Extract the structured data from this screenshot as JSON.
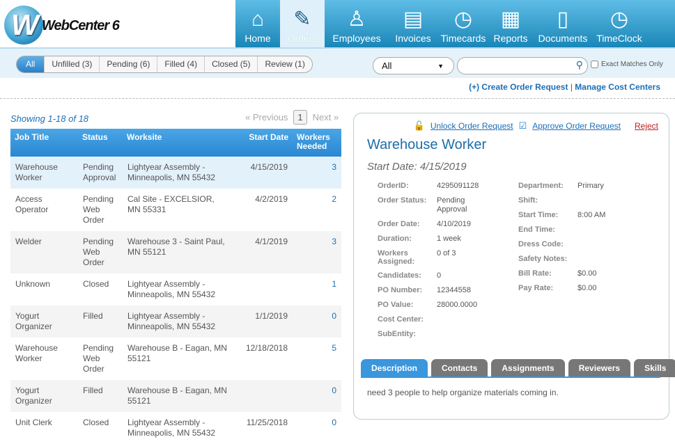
{
  "app": {
    "logo_text": "WebCenter 6",
    "logo_letter": "W"
  },
  "nav": [
    {
      "label": "Home",
      "icon": "home-icon",
      "glyph": "⌂"
    },
    {
      "label": "Orders",
      "icon": "notepad-pencil-icon",
      "glyph": "✎",
      "active": true
    },
    {
      "label": "Employees",
      "icon": "person-icon",
      "glyph": "♙"
    },
    {
      "label": "Invoices",
      "icon": "invoice-icon",
      "glyph": "▤"
    },
    {
      "label": "Timecards",
      "icon": "clock-icon",
      "glyph": "◷"
    },
    {
      "label": "Reports",
      "icon": "report-download-icon",
      "glyph": "▦"
    },
    {
      "label": "Documents",
      "icon": "document-icon",
      "glyph": "▯"
    },
    {
      "label": "TimeClock",
      "icon": "clock-icon",
      "glyph": "◷"
    }
  ],
  "filters": [
    "All",
    "Unfilled (3)",
    "Pending (6)",
    "Filled (4)",
    "Closed (5)",
    "Review (1)"
  ],
  "search": {
    "select_value": "All",
    "value": "",
    "exact_label": "Exact Matches Only"
  },
  "links": {
    "create": "(+) Create Order Request",
    "sep": "|",
    "manage": "Manage Cost Centers"
  },
  "list": {
    "showing": "Showing 1-18 of 18",
    "prev": "« Previous",
    "page": "1",
    "next": "Next »",
    "columns": [
      "Job Title",
      "Status",
      "Worksite",
      "Start Date",
      "Workers Needed"
    ],
    "rows": [
      [
        "Warehouse Worker",
        "Pending Approval",
        "Lightyear Assembly - Minneapolis, MN 55432",
        "4/15/2019",
        "3"
      ],
      [
        "Access Operator",
        "Pending Web Order",
        "Cal Site - EXCELSIOR, MN 55331",
        "4/2/2019",
        "2"
      ],
      [
        "Welder",
        "Pending Web Order",
        "Warehouse 3 - Saint Paul, MN 55121",
        "4/1/2019",
        "3"
      ],
      [
        "Unknown",
        "Closed",
        "Lightyear Assembly - Minneapolis, MN 55432",
        "",
        "1"
      ],
      [
        "Yogurt Organizer",
        "Filled",
        "Lightyear Assembly - Minneapolis, MN 55432",
        "1/1/2019",
        "0"
      ],
      [
        "Warehouse Worker",
        "Pending Web Order",
        "Warehouse B - Eagan, MN 55121",
        "12/18/2018",
        "5"
      ],
      [
        "Yogurt Organizer",
        "Filled",
        "Warehouse B - Eagan, MN 55121",
        "",
        "0"
      ],
      [
        "Unit Clerk",
        "Closed",
        "Lightyear Assembly - Minneapolis, MN 55432",
        "11/25/2018",
        "0"
      ]
    ]
  },
  "detail": {
    "unlock": "Unlock Order Request",
    "approve": "Approve Order Request",
    "reject": "Reject",
    "title": "Warehouse Worker",
    "start_date": "Start Date: 4/15/2019",
    "left": [
      [
        "OrderID:",
        "4295091128"
      ],
      [
        "Order Status:",
        "Pending Approval"
      ],
      [
        "Order Date:",
        "4/10/2019"
      ],
      [
        "Duration:",
        "1 week"
      ],
      [
        "Workers Assigned:",
        "0 of 3"
      ],
      [
        "Candidates:",
        "0"
      ],
      [
        "PO Number:",
        "12344558"
      ],
      [
        "PO Value:",
        "28000.0000"
      ],
      [
        "Cost Center:",
        ""
      ],
      [
        "SubEntity:",
        ""
      ]
    ],
    "right": [
      [
        "Department:",
        "Primary"
      ],
      [
        "Shift:",
        ""
      ],
      [
        "Start Time:",
        "8:00 AM"
      ],
      [
        "End Time:",
        ""
      ],
      [
        "Dress Code:",
        ""
      ],
      [
        "Safety Notes:",
        ""
      ],
      [
        "Bill Rate:",
        "$0.00"
      ],
      [
        "Pay Rate:",
        "$0.00"
      ]
    ],
    "tabs": [
      "Description",
      "Contacts",
      "Assignments",
      "Reviewers",
      "Skills"
    ],
    "description": "need 3 people to help organize materials coming in."
  }
}
